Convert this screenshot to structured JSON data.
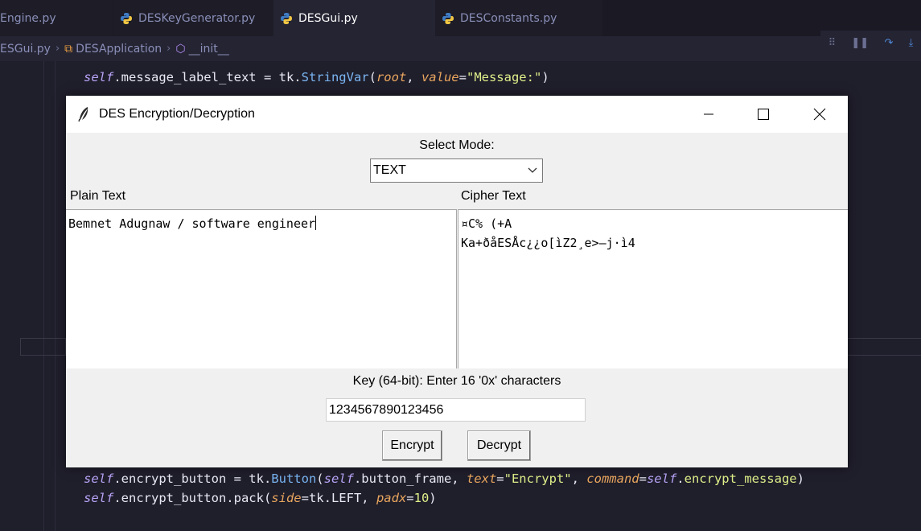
{
  "editor_tabs": [
    {
      "label": "Engine.py"
    },
    {
      "label": "DESKeyGenerator.py"
    },
    {
      "label": "DESGui.py"
    },
    {
      "label": "DESConstants.py"
    }
  ],
  "breadcrumb": {
    "file": "ESGui.py",
    "class": "DESApplication",
    "method": "__init__"
  },
  "code": {
    "line1": {
      "self": "self",
      "a": ".message_label_text = tk.",
      "fn": "StringVar",
      "b": "(",
      "root": "root",
      "c": ", ",
      "value": "value",
      "d": "=",
      "str": "\"Message:\"",
      "e": ")"
    },
    "line2": {
      "self": "self",
      "a": ".encrypt_button = tk.",
      "fn": "Button",
      "b": "(",
      "self2": "self",
      "c": ".button_frame, ",
      "text": "text",
      "d": "=",
      "str": "\"Encrypt\"",
      "e": ", ",
      "command": "command",
      "f": "=",
      "self3": "self",
      "g": ".",
      "fn2": "encrypt_message",
      "h": ")"
    },
    "line3": {
      "self": "self",
      "a": ".encrypt_button.pack(",
      "side": "side",
      "b": "=tk.LEFT, ",
      "padx": "padx",
      "c": "=",
      "num": "10",
      "d": ")"
    }
  },
  "dialog": {
    "title": "DES Encryption/Decryption",
    "select_mode_label": "Select Mode:",
    "mode_selected": "TEXT",
    "plain_label": "Plain Text",
    "cipher_label": "Cipher Text",
    "plain_text": "Bemnet Adugnaw / software engineer",
    "cipher_line1": "¤C\u0014% (+A\u0016 \u0018",
    "cipher_line2": "Ka+ðåESÅ\u0012c¿¿o[ìZ2¸e\u0010>–j·ì4",
    "key_label": "Key (64-bit): Enter 16 '0x' characters",
    "key_value": "1234567890123456",
    "encrypt_label": "Encrypt",
    "decrypt_label": "Decrypt"
  }
}
